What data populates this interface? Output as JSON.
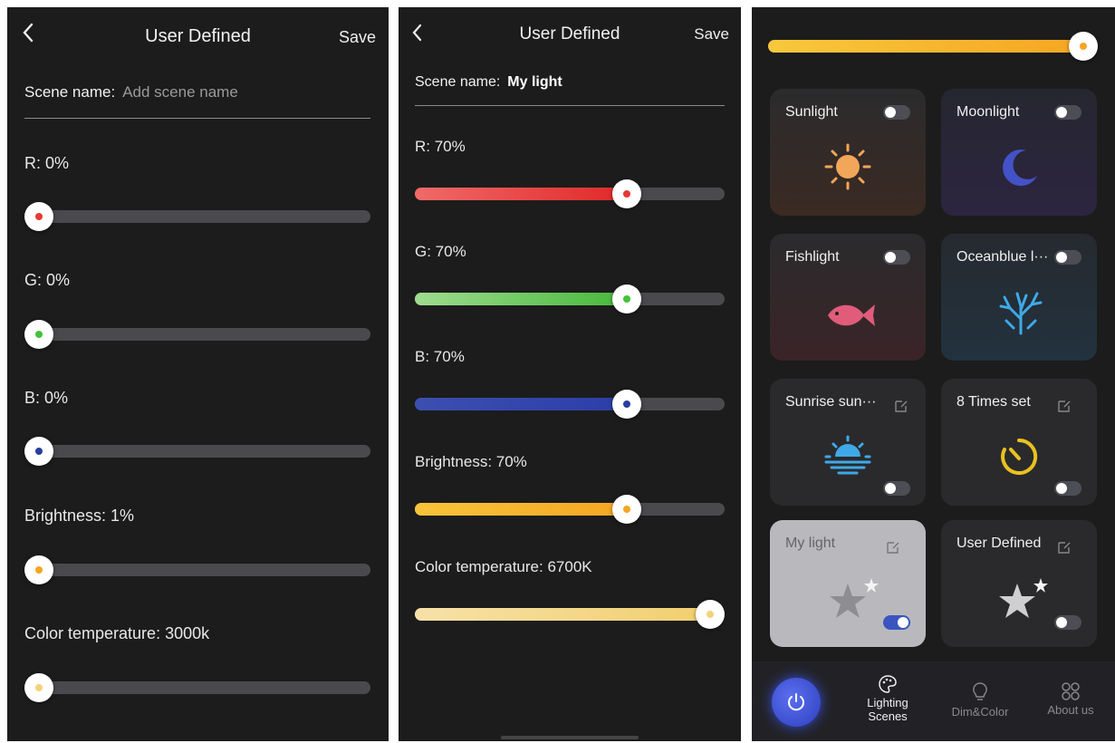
{
  "screen1": {
    "title": "User Defined",
    "save_label": "Save",
    "scene_name_label": "Scene name:",
    "scene_name_placeholder": "Add scene name",
    "sliders": [
      {
        "label": "R: 0%",
        "value": 0,
        "color": "#e53935"
      },
      {
        "label": "G: 0%",
        "value": 0,
        "color": "#43c23b"
      },
      {
        "label": "B: 0%",
        "value": 0,
        "color": "#2a3f9f"
      },
      {
        "label": "Brightness: 1%",
        "value": 1,
        "color": "#f5a623"
      },
      {
        "label": "Color temperature: 3000k",
        "value": 0,
        "color": "#f4d27a"
      }
    ]
  },
  "screen2": {
    "title": "User Defined",
    "save_label": "Save",
    "scene_name_label": "Scene name:",
    "scene_name_value": "My light",
    "sliders": [
      {
        "label": "R: 70%",
        "value": 70,
        "color": "#e53935"
      },
      {
        "label": "G: 70%",
        "value": 70,
        "color": "#43c23b"
      },
      {
        "label": "B: 70%",
        "value": 70,
        "color": "#2a3f9f"
      },
      {
        "label": "Brightness: 70%",
        "value": 70,
        "color": "#f5a623"
      },
      {
        "label": "Color temperature: 6700K",
        "value": 100,
        "color": "#f4d27a"
      }
    ]
  },
  "screen3": {
    "brightness_value": 100,
    "cards": [
      {
        "name": "Sunlight",
        "icon": "sun-icon",
        "toggle_on": false,
        "editable": false
      },
      {
        "name": "Moonlight",
        "icon": "moon-icon",
        "toggle_on": false,
        "editable": false
      },
      {
        "name": "Fishlight",
        "icon": "fish-icon",
        "toggle_on": false,
        "editable": false
      },
      {
        "name": "Oceanblue l···",
        "icon": "coral-icon",
        "toggle_on": false,
        "editable": false
      },
      {
        "name": "Sunrise sun···",
        "icon": "sunrise-icon",
        "toggle_on": false,
        "editable": true
      },
      {
        "name": "8 Times set",
        "icon": "timer-icon",
        "toggle_on": false,
        "editable": true
      },
      {
        "name": "My light",
        "icon": "star-icon",
        "toggle_on": true,
        "editable": true
      },
      {
        "name": "User Defined",
        "icon": "star-icon",
        "toggle_on": false,
        "editable": true
      }
    ],
    "nav": [
      {
        "label": "Lighting\nScenes",
        "icon": "palette-icon",
        "active": true
      },
      {
        "label": "Dim&Color",
        "icon": "bulb-icon",
        "active": false
      },
      {
        "label": "About us",
        "icon": "grid-icon",
        "active": false
      }
    ],
    "accent": "#3a55c0"
  }
}
